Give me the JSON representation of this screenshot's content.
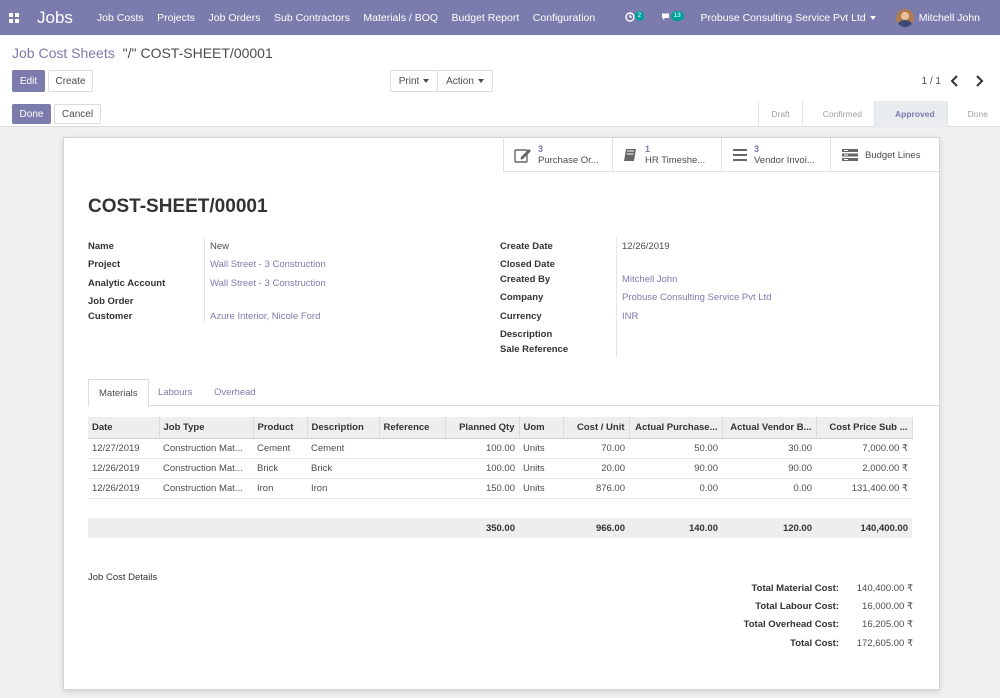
{
  "navbar": {
    "app_name": "Jobs",
    "menu": [
      "Job Costs",
      "Projects",
      "Job Orders",
      "Sub Contractors",
      "Materials / BOQ",
      "Budget Report",
      "Configuration"
    ],
    "activity_count": "2",
    "message_count": "13",
    "company": "Probuse Consulting Service Pvt Ltd",
    "user": "Mitchell John",
    "color": "#7c7bad"
  },
  "control_panel": {
    "breadcrumb_parent": "Job Cost Sheets",
    "breadcrumb_sep": "\"/\"",
    "breadcrumb_current": "COST-SHEET/00001",
    "edit": "Edit",
    "create": "Create",
    "print": "Print",
    "action": "Action",
    "pager": "1 / 1",
    "done": "Done",
    "cancel": "Cancel",
    "stages": [
      "Draft",
      "Confirmed",
      "Approved",
      "Done"
    ],
    "active_stage": "Approved"
  },
  "smart_buttons": [
    {
      "value": "3",
      "label": "Purchase Or...",
      "icon": "edit-icon"
    },
    {
      "value": "1",
      "label": "HR Timeshe...",
      "icon": "book-icon"
    },
    {
      "value": "3",
      "label": "Vendor Invoi...",
      "icon": "list-icon"
    },
    {
      "value": "",
      "label": "Budget Lines",
      "icon": "budget-icon"
    }
  ],
  "record": {
    "title": "COST-SHEET/00001",
    "left_fields": [
      {
        "label": "Name",
        "value": "New"
      },
      {
        "label": "Project",
        "value": "Wall Street - 3 Construction"
      },
      {
        "label": "Analytic Account",
        "value": "Wall Street - 3 Construction"
      },
      {
        "label": "Job Order",
        "value": ""
      },
      {
        "label": "Customer",
        "value": "Azure Interior, Nicole Ford"
      }
    ],
    "right_fields": [
      {
        "label": "Create Date",
        "value": "12/26/2019"
      },
      {
        "label": "Closed Date",
        "value": ""
      },
      {
        "label": "Created By",
        "value": "Mitchell John"
      },
      {
        "label": "Company",
        "value": "Probuse Consulting Service Pvt Ltd"
      },
      {
        "label": "Currency",
        "value": "INR"
      },
      {
        "label": "Description",
        "value": ""
      },
      {
        "label": "Sale Reference",
        "value": ""
      }
    ]
  },
  "tabs": [
    "Materials",
    "Labours",
    "Overhead"
  ],
  "lines": {
    "headers": [
      "Date",
      "Job Type",
      "Product",
      "Description",
      "Reference",
      "Planned Qty",
      "Uom",
      "Cost / Unit",
      "Actual Purchase...",
      "Actual Vendor B...",
      "Cost Price Sub ..."
    ],
    "rows": [
      [
        "12/27/2019",
        "Construction Mat...",
        "Cement",
        "Cement",
        "",
        "100.00",
        "Units",
        "70.00",
        "50.00",
        "30.00",
        "7,000.00 ₹"
      ],
      [
        "12/26/2019",
        "Construction Mat...",
        "Brick",
        "Brick",
        "",
        "100.00",
        "Units",
        "20.00",
        "90.00",
        "90.00",
        "2,000.00 ₹"
      ],
      [
        "12/26/2019",
        "Construction Mat...",
        "Iron",
        "Iron",
        "",
        "150.00",
        "Units",
        "876.00",
        "0.00",
        "0.00",
        "131,400.00 ₹"
      ]
    ],
    "totals": [
      "",
      "",
      "",
      "",
      "",
      "350.00",
      "",
      "966.00",
      "140.00",
      "120.00",
      "140,400.00"
    ]
  },
  "details_label": "Job Cost Details",
  "summary": [
    {
      "label": "Total Material Cost:",
      "value": "140,400.00 ₹"
    },
    {
      "label": "Total Labour Cost:",
      "value": "16,000.00 ₹"
    },
    {
      "label": "Total Overhead Cost:",
      "value": "16,205.00 ₹"
    },
    {
      "label": "Total Cost:",
      "value": "172,605.00 ₹"
    }
  ]
}
